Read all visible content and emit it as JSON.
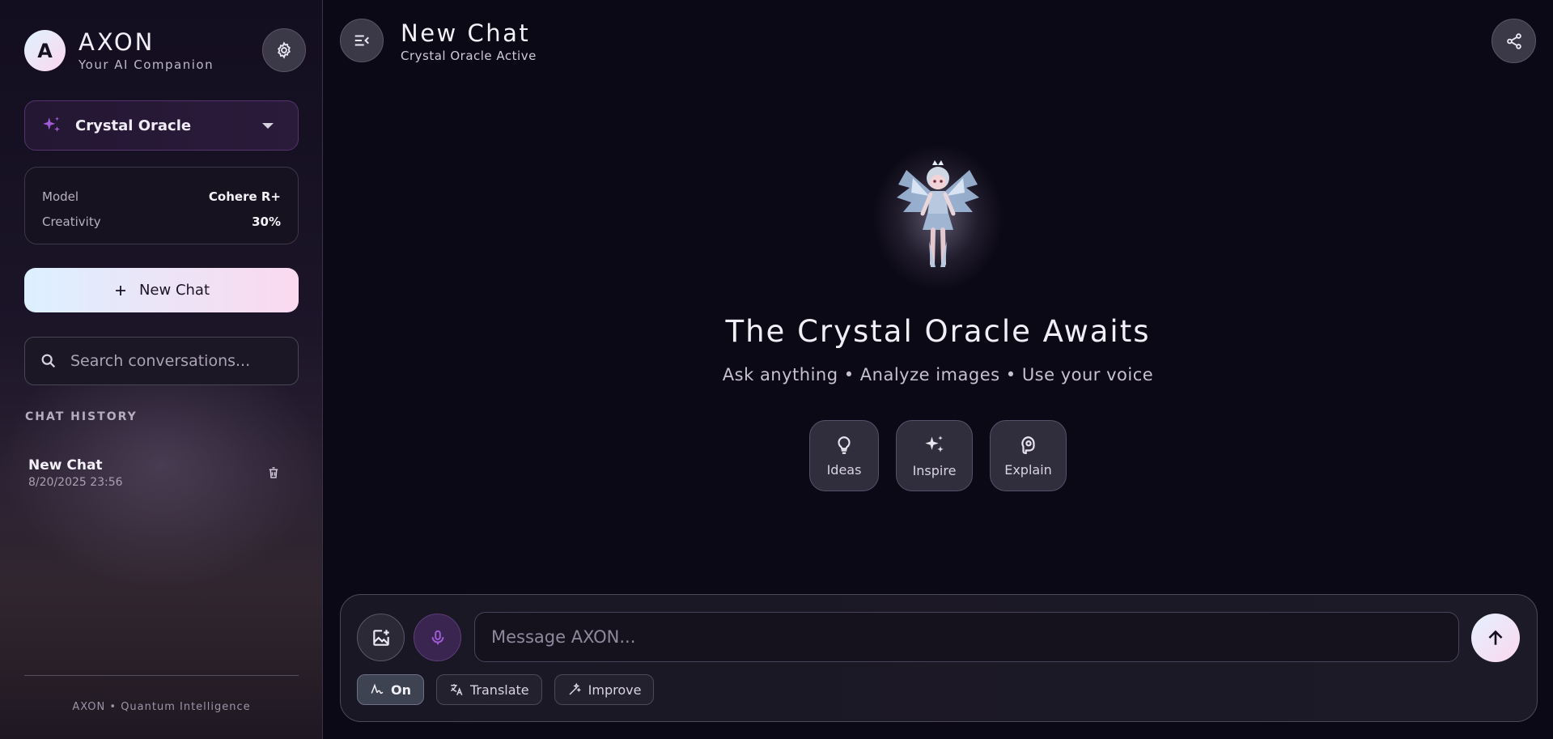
{
  "sidebar": {
    "brand": {
      "initial": "A",
      "name": "AXON",
      "tagline": "Your AI Companion"
    },
    "persona": {
      "selected": "Crystal Oracle"
    },
    "info": [
      {
        "label": "Model",
        "value": "Cohere R+"
      },
      {
        "label": "Creativity",
        "value": "30%"
      }
    ],
    "new_chat_label": "New Chat",
    "search": {
      "placeholder": "Search conversations...",
      "value": ""
    },
    "history_title": "CHAT HISTORY",
    "history": [
      {
        "title": "New Chat",
        "date": "8/20/2025 23:56"
      }
    ],
    "footer": "AXON • Quantum Intelligence"
  },
  "header": {
    "title": "New Chat",
    "subtitle": "Crystal Oracle Active"
  },
  "hero": {
    "title": "The Crystal Oracle Awaits",
    "subtitle": "Ask anything • Analyze images • Use your voice",
    "actions": [
      {
        "label": "Ideas",
        "icon": "lightbulb-icon"
      },
      {
        "label": "Inspire",
        "icon": "sparkles-icon"
      },
      {
        "label": "Explain",
        "icon": "brain-icon"
      }
    ]
  },
  "composer": {
    "placeholder": "Message AXON...",
    "value": "",
    "chips": [
      {
        "label": "On",
        "icon": "handwriting-icon",
        "active": true
      },
      {
        "label": "Translate",
        "icon": "translate-icon",
        "active": false
      },
      {
        "label": "Improve",
        "icon": "magic-wand-icon",
        "active": false
      }
    ]
  },
  "colors": {
    "accent_purple": "#a05cd6",
    "gradient_start": "#dcf0ff",
    "gradient_end": "#fbd9ef",
    "background": "#0c0916"
  }
}
